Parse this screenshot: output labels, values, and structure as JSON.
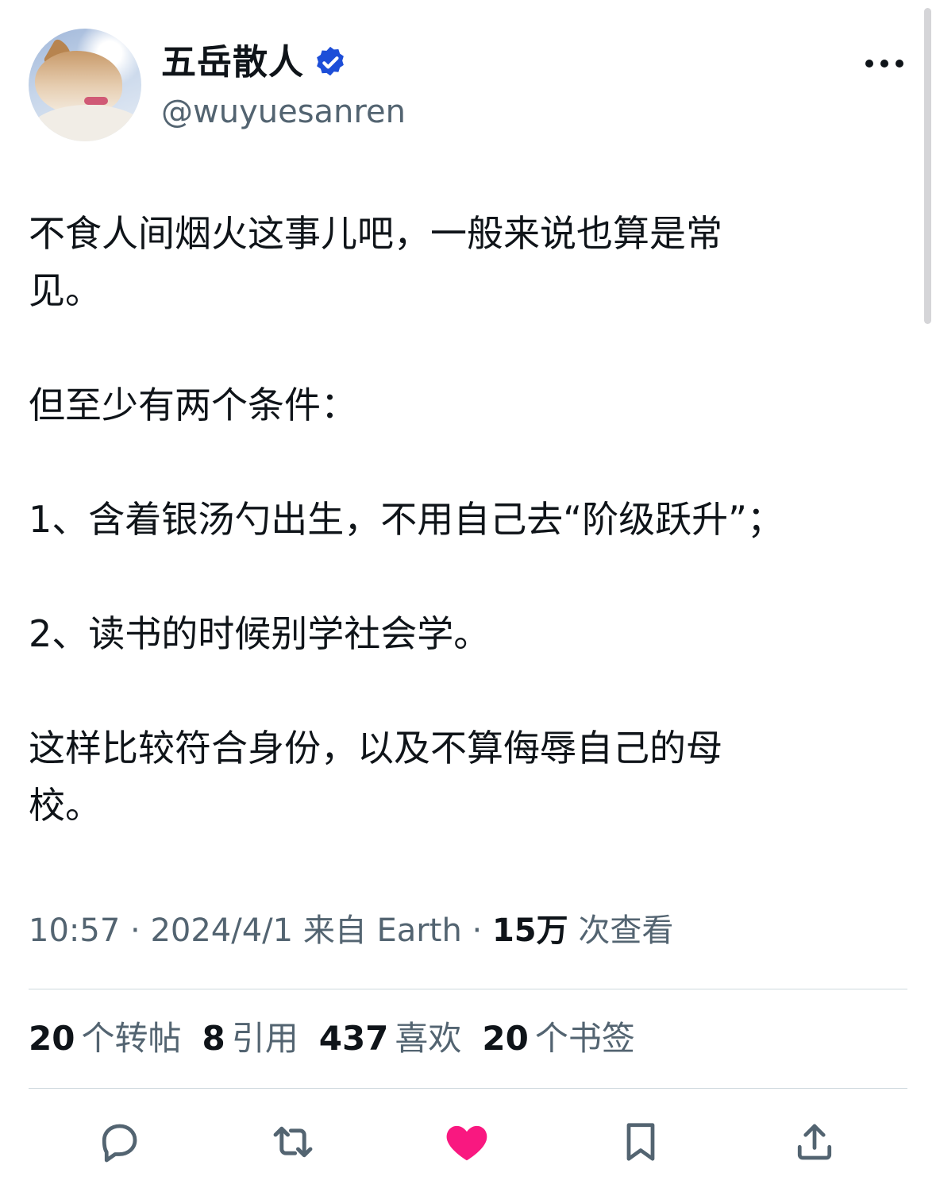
{
  "author": {
    "display_name": "五岳散人",
    "handle": "@wuyuesanren",
    "verified": true,
    "badge_color": "#1d4ed8"
  },
  "tweet": {
    "text": "不食人间烟火这事儿吧，一般来说也算是常\n见。\n\n但至少有两个条件：\n\n1、含着银汤勺出生，不用自己去“阶级跃升”；\n\n2、读书的时候别学社会学。\n\n这样比较符合身份，以及不算侮辱自己的母\n校。"
  },
  "meta": {
    "time": "10:57",
    "date": "2024/4/1",
    "source": "来自 Earth",
    "views_count": "15万",
    "views_label": "次查看",
    "separator": "·"
  },
  "stats": [
    {
      "count": "20",
      "label": "个转帖"
    },
    {
      "count": "8",
      "label": "引用"
    },
    {
      "count": "437",
      "label": "喜欢"
    },
    {
      "count": "20",
      "label": "个书签"
    }
  ],
  "actions": {
    "reply_icon": "reply-icon",
    "retweet_icon": "retweet-icon",
    "like_icon": "heart-filled-icon",
    "like_color": "#f91880",
    "bookmark_icon": "bookmark-icon",
    "share_icon": "share-icon"
  }
}
